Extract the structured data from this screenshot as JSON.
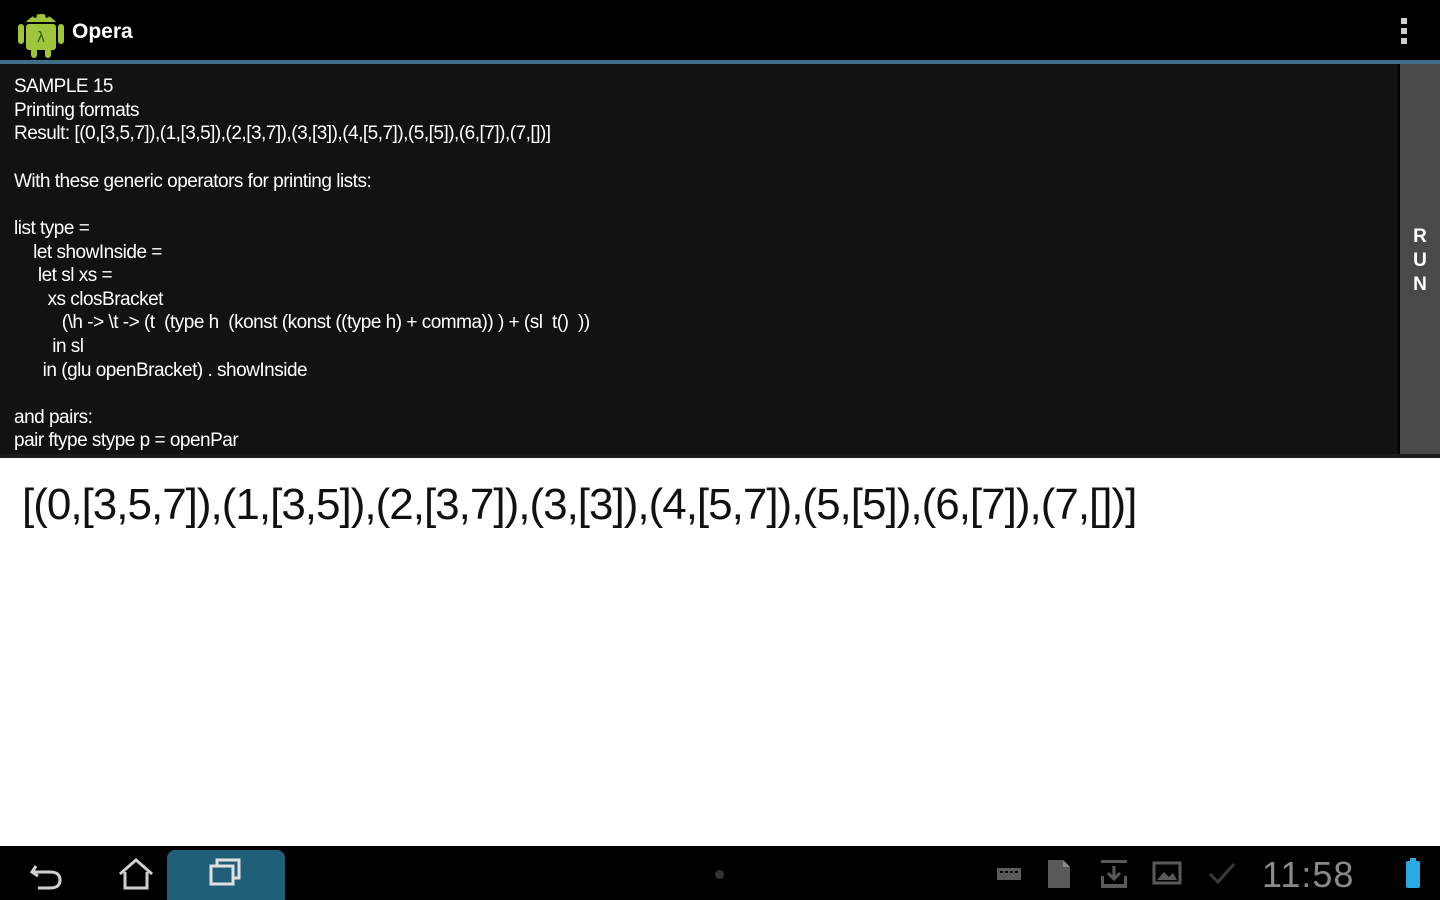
{
  "app": {
    "title": "Opera"
  },
  "code": {
    "lines": [
      "SAMPLE 15",
      "Printing formats",
      "Result: [(0,[3,5,7]),(1,[3,5]),(2,[3,7]),(3,[3]),(4,[5,7]),(5,[5]),(6,[7]),(7,[])]",
      "",
      "With these generic operators for printing lists:",
      "",
      "list type =",
      "    let showInside =",
      "     let sl xs =",
      "       xs closBracket",
      "          (\\h -> \\t -> (t  (type h  (konst (konst ((type h) + comma)) ) + (sl  t()  ))",
      "        in sl",
      "      in (glu openBracket) . showInside",
      "",
      "and pairs:",
      "pair ftype stype p = openPar"
    ]
  },
  "run_button": {
    "letters": [
      "R",
      "U",
      "N"
    ]
  },
  "output": {
    "text": "[(0,[3,5,7]),(1,[3,5]),(2,[3,7]),(3,[3]),(4,[5,7]),(5,[5]),(6,[7]),(7,[])]"
  },
  "system_bar": {
    "clock": "11:58"
  },
  "colors": {
    "accent_line": "#3f6f8a",
    "recents_highlight": "#1f5f7a",
    "run_bar": "#4a4a4a"
  },
  "icons": [
    "android-app-icon",
    "overflow-menu-icon",
    "back-icon",
    "home-icon",
    "recents-icon",
    "keyboard-icon",
    "file-icon",
    "download-icon",
    "image-icon",
    "check-icon",
    "battery-icon"
  ]
}
